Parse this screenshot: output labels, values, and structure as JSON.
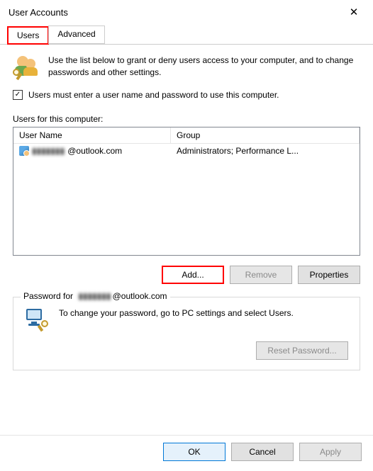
{
  "window": {
    "title": "User Accounts"
  },
  "tabs": {
    "users": "Users",
    "advanced": "Advanced"
  },
  "intro": "Use the list below to grant or deny users access to your computer, and to change passwords and other settings.",
  "checkbox": {
    "checked": "✓",
    "label": "Users must enter a user name and password to use this computer."
  },
  "users_section": {
    "label": "Users for this computer:",
    "columns": {
      "username": "User Name",
      "group": "Group"
    },
    "rows": [
      {
        "username_hidden": "▮▮▮▮▮▮▮",
        "username_suffix": "@outlook.com",
        "group": "Administrators; Performance L..."
      }
    ]
  },
  "buttons": {
    "add": "Add...",
    "remove": "Remove",
    "properties": "Properties"
  },
  "password_group": {
    "title_prefix": "Password for",
    "title_hidden": "▮▮▮▮▮▮▮",
    "title_suffix": "@outlook.com",
    "text": "To change your password, go to PC settings and select Users.",
    "reset": "Reset Password..."
  },
  "footer": {
    "ok": "OK",
    "cancel": "Cancel",
    "apply": "Apply"
  }
}
